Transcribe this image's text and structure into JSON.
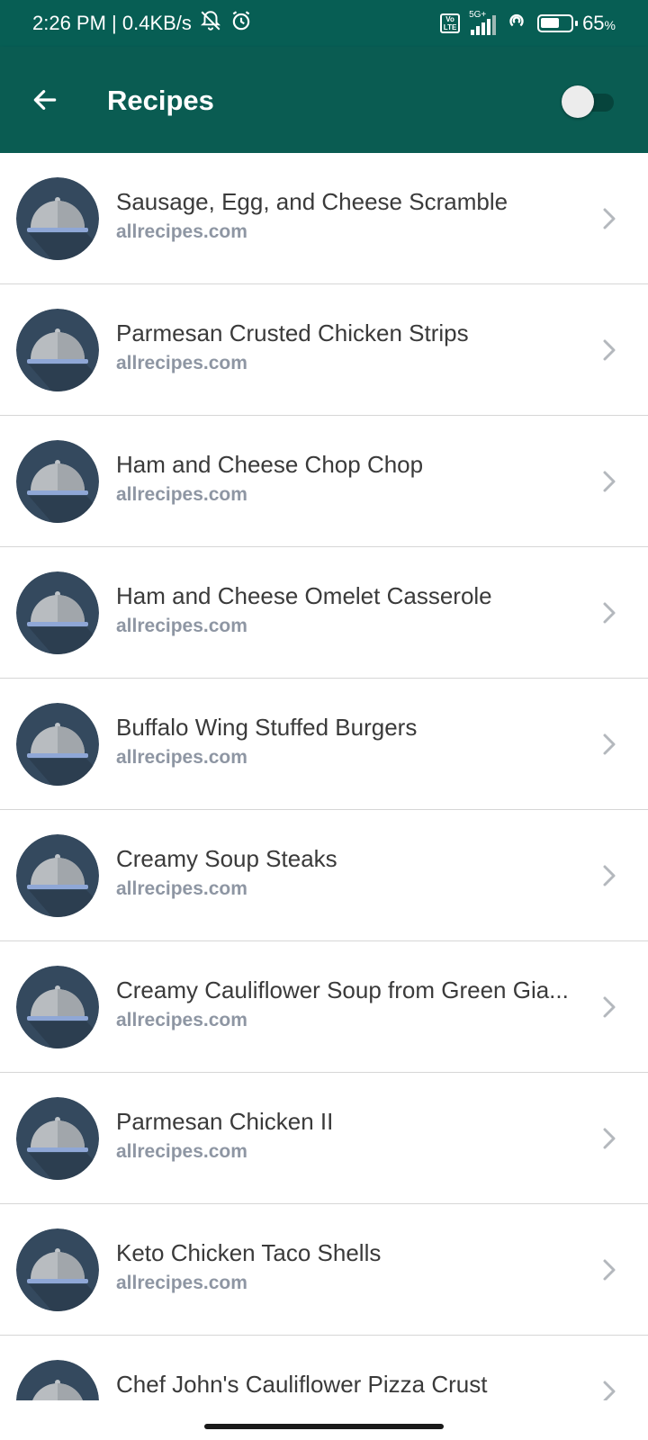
{
  "status_bar": {
    "time_speed": "2:26 PM | 0.4KB/s",
    "network": "5G+",
    "volte": "Vo LTE",
    "battery": "65",
    "battery_unit": "%",
    "battery_level": 0.65
  },
  "app_bar": {
    "title": "Recipes",
    "toggle_on": false
  },
  "recipes": [
    {
      "title": "Sausage, Egg, and Cheese Scramble",
      "source": "allrecipes.com"
    },
    {
      "title": "Parmesan Crusted Chicken Strips",
      "source": "allrecipes.com"
    },
    {
      "title": "Ham and Cheese Chop Chop",
      "source": "allrecipes.com"
    },
    {
      "title": "Ham and Cheese Omelet Casserole",
      "source": "allrecipes.com"
    },
    {
      "title": "Buffalo Wing Stuffed Burgers",
      "source": "allrecipes.com"
    },
    {
      "title": "Creamy Soup Steaks",
      "source": "allrecipes.com"
    },
    {
      "title": "Creamy Cauliflower Soup from Green Gia...",
      "source": "allrecipes.com"
    },
    {
      "title": "Parmesan Chicken II",
      "source": "allrecipes.com"
    },
    {
      "title": "Keto Chicken Taco Shells",
      "source": "allrecipes.com"
    },
    {
      "title": "Chef John's Cauliflower Pizza Crust",
      "source": ""
    }
  ],
  "colors": {
    "app_bar": "#0a5c52",
    "status_bar": "#075e54",
    "avatar_bg": "#34495e",
    "source_text": "#8e96a3"
  },
  "icons": {
    "back": "arrow-left-icon",
    "avatar": "food-cloche-icon",
    "row_action": "chevron-right-icon"
  }
}
